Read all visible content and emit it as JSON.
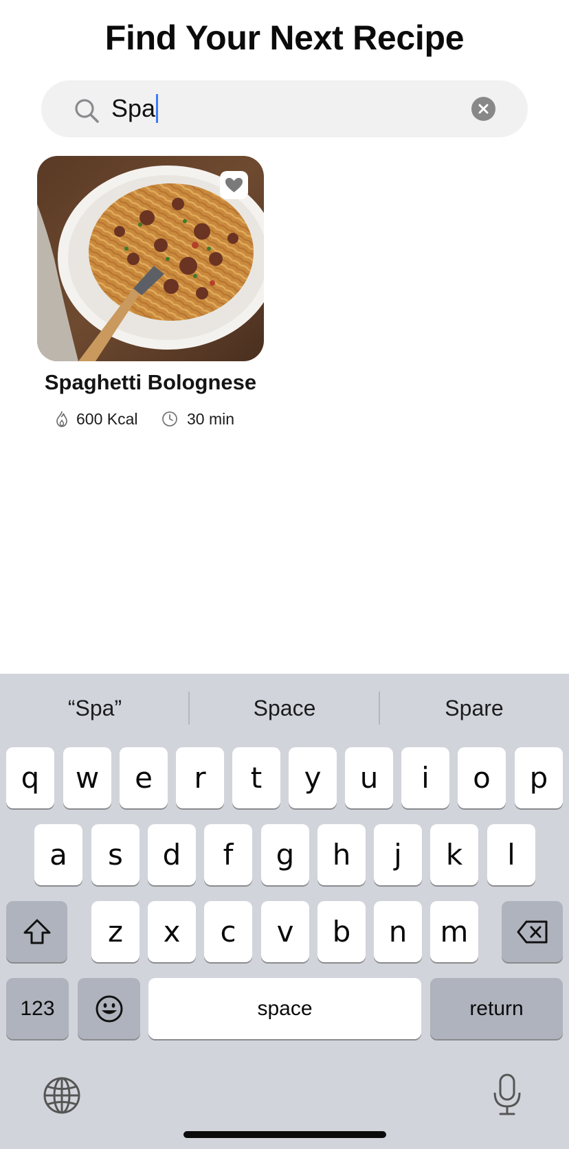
{
  "header": {
    "title": "Find Your Next Recipe"
  },
  "search": {
    "query": "Spa",
    "search_icon": "magnifier-icon",
    "clear_icon": "clear-x-icon"
  },
  "results": [
    {
      "name": "Spaghetti Bolognese",
      "image": "spaghetti-bolognese-photo",
      "favorite_icon": "heart-icon",
      "calories": "600 Kcal",
      "time": "30 min"
    }
  ],
  "keyboard": {
    "suggestions": [
      "“Spa”",
      "Space",
      "Spare"
    ],
    "row1": [
      "q",
      "w",
      "e",
      "r",
      "t",
      "y",
      "u",
      "i",
      "o",
      "p"
    ],
    "row2": [
      "a",
      "s",
      "d",
      "f",
      "g",
      "h",
      "j",
      "k",
      "l"
    ],
    "row3": [
      "z",
      "x",
      "c",
      "v",
      "b",
      "n",
      "m"
    ],
    "numbers_label": "123",
    "space_label": "space",
    "return_label": "return"
  },
  "colors": {
    "keyboard_bg": "#d1d4da",
    "search_bg": "#f1f1f1",
    "caret": "#3a7cf6",
    "dark_key": "#aeb3bd"
  }
}
